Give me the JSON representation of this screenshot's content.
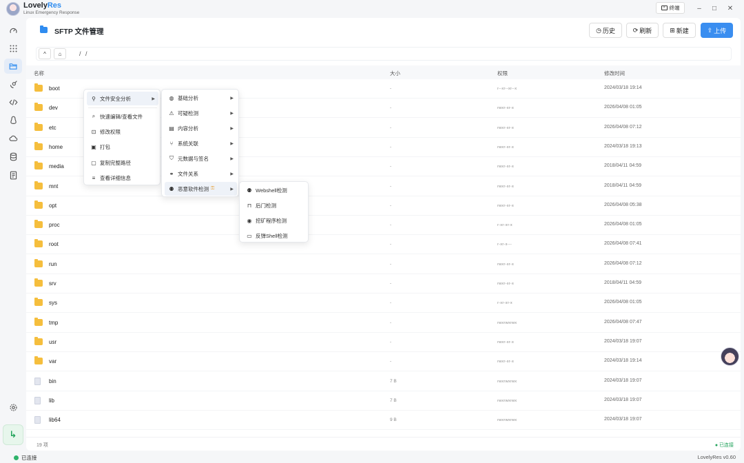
{
  "app": {
    "name_primary": "Lovely",
    "name_accent": "Res",
    "subtitle": "Linux Emergency Response",
    "terminal_label": "终端",
    "controls": {
      "minimize": "–",
      "maximize": "□",
      "close": "✕"
    }
  },
  "header": {
    "title": "SFTP 文件管理",
    "buttons": {
      "history": "历史",
      "refresh": "刷新",
      "new": "新建",
      "upload": "上传"
    }
  },
  "pathbar": {
    "up": "^",
    "path": "/ /"
  },
  "table": {
    "columns": {
      "name": "名称",
      "size": "大小",
      "perms": "权限",
      "mtime": "修改时间"
    },
    "rows": [
      {
        "name": "boot",
        "size": "-",
        "perms": "r--xr--xr--x",
        "mtime": "2024/03/18 19:14"
      },
      {
        "name": "dev",
        "size": "-",
        "perms": "rwxr-xr-x",
        "mtime": "2026/04/08 01:05"
      },
      {
        "name": "etc",
        "size": "-",
        "perms": "rwxr-xr-x",
        "mtime": "2026/04/08 07:12"
      },
      {
        "name": "home",
        "size": "-",
        "perms": "rwxr-xr-x",
        "mtime": "2024/03/18 19:13"
      },
      {
        "name": "media",
        "size": "-",
        "perms": "rwxr-xr-x",
        "mtime": "2018/04/11 04:59"
      },
      {
        "name": "mnt",
        "size": "-",
        "perms": "rwxr-xr-x",
        "mtime": "2018/04/11 04:59"
      },
      {
        "name": "opt",
        "size": "-",
        "perms": "rwxr-xr-x",
        "mtime": "2026/04/08 05:38"
      },
      {
        "name": "proc",
        "size": "-",
        "perms": "r-xr-xr-x",
        "mtime": "2026/04/08 01:05"
      },
      {
        "name": "root",
        "size": "-",
        "perms": "r-xr-x---",
        "mtime": "2026/04/08 07:41"
      },
      {
        "name": "run",
        "size": "-",
        "perms": "rwxr-xr-x",
        "mtime": "2026/04/08 07:12"
      },
      {
        "name": "srv",
        "size": "-",
        "perms": "rwxr-xr-x",
        "mtime": "2018/04/11 04:59"
      },
      {
        "name": "sys",
        "size": "-",
        "perms": "r-xr-xr-x",
        "mtime": "2026/04/08 01:05"
      },
      {
        "name": "tmp",
        "size": "-",
        "perms": "rwxrwxrwx",
        "mtime": "2026/04/08 07:47"
      },
      {
        "name": "usr",
        "size": "-",
        "perms": "rwxr-xr-x",
        "mtime": "2024/03/18 19:07"
      },
      {
        "name": "var",
        "size": "-",
        "perms": "rwxr-xr-x",
        "mtime": "2024/03/18 19:14"
      },
      {
        "name": "bin",
        "size": "7 B",
        "perms": "rwxrwxrwx",
        "mtime": "2024/03/18 19:07"
      },
      {
        "name": "lib",
        "size": "7 B",
        "perms": "rwxrwxrwx",
        "mtime": "2024/03/18 19:07"
      },
      {
        "name": "lib64",
        "size": "9 B",
        "perms": "rwxrwxrwx",
        "mtime": "2024/03/18 19:07"
      }
    ]
  },
  "footer": {
    "count": "19 项",
    "connection": "● 已连接"
  },
  "statusbar": {
    "connection": "已连接",
    "version": "LovelyRes v0.60"
  },
  "context_menu": {
    "items": {
      "security_analysis": "文件安全分析",
      "quick_edit": "快速编辑/查看文件",
      "modify_perms": "修改权限",
      "pack": "打包",
      "copy_path": "复制完整路径",
      "view_details": "查看详细信息"
    },
    "submenu": {
      "basic": "基础分析",
      "suspicious": "可疑检测",
      "content": "内容分析",
      "system": "系统关联",
      "metadata": "元数据与签名",
      "relation": "文件关系",
      "malware": "恶意软件检测"
    },
    "malware_submenu": {
      "webshell": "Webshell检测",
      "backdoor": "后门检测",
      "miner": "挖矿程序检测",
      "reverse_shell": "反弹Shell检测"
    }
  },
  "colors": {
    "accent": "#2f8cf0",
    "folder": "#f5be3d",
    "connected": "#2fb36b"
  }
}
